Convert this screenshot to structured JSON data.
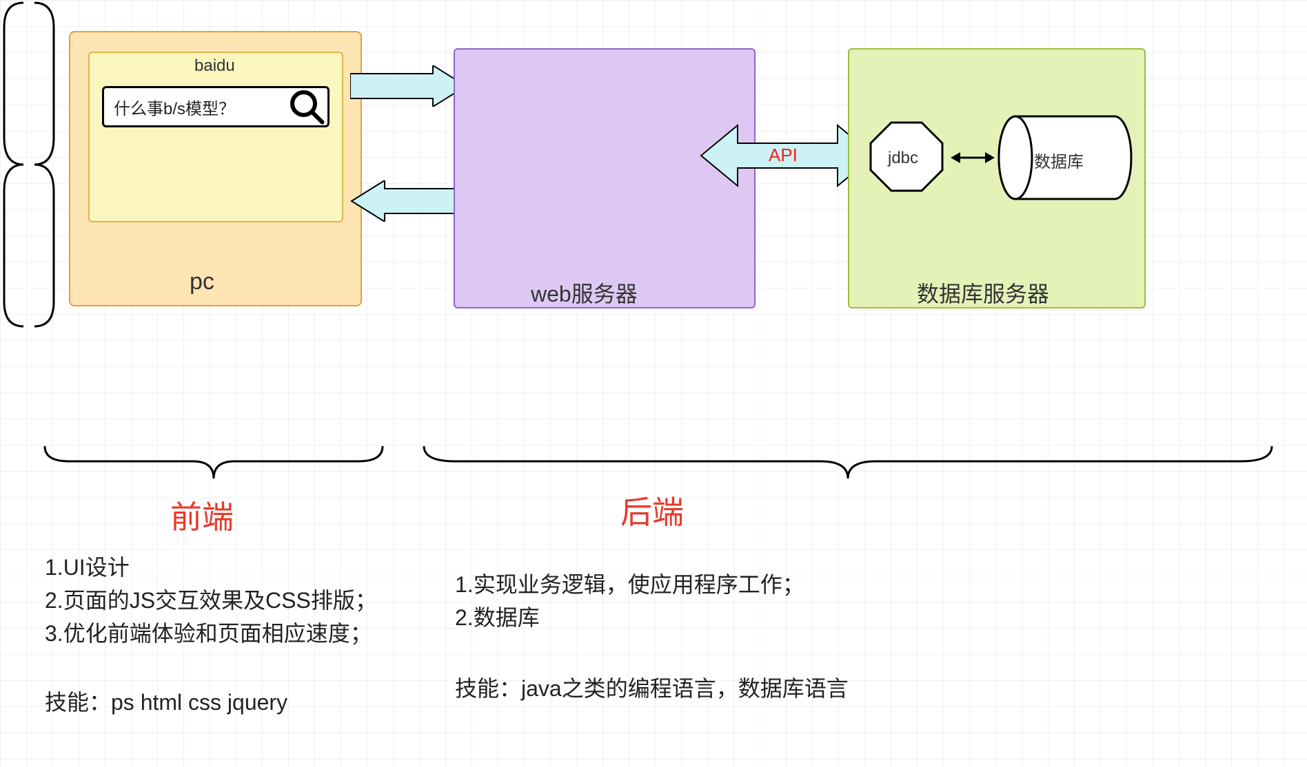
{
  "pc": {
    "title": "baidu",
    "search_text": "什么事b/s模型？",
    "label": "pc"
  },
  "web": {
    "label": "web服务器"
  },
  "api_label": "API",
  "jdbc_label": "jdbc",
  "database_label": "数据库",
  "db_server_label": "数据库服务器",
  "frontend": {
    "heading": "前端",
    "line1": "1.UI设计",
    "line2": "2.页面的JS交互效果及CSS排版；",
    "line3": "3.优化前端体验和页面相应速度；",
    "skills": "技能：ps html css jquery"
  },
  "backend": {
    "heading": "后端",
    "line1": "1.实现业务逻辑，使应用程序工作；",
    "line2": "2.数据库",
    "skills": "技能：java之类的编程语言，数据库语言"
  }
}
